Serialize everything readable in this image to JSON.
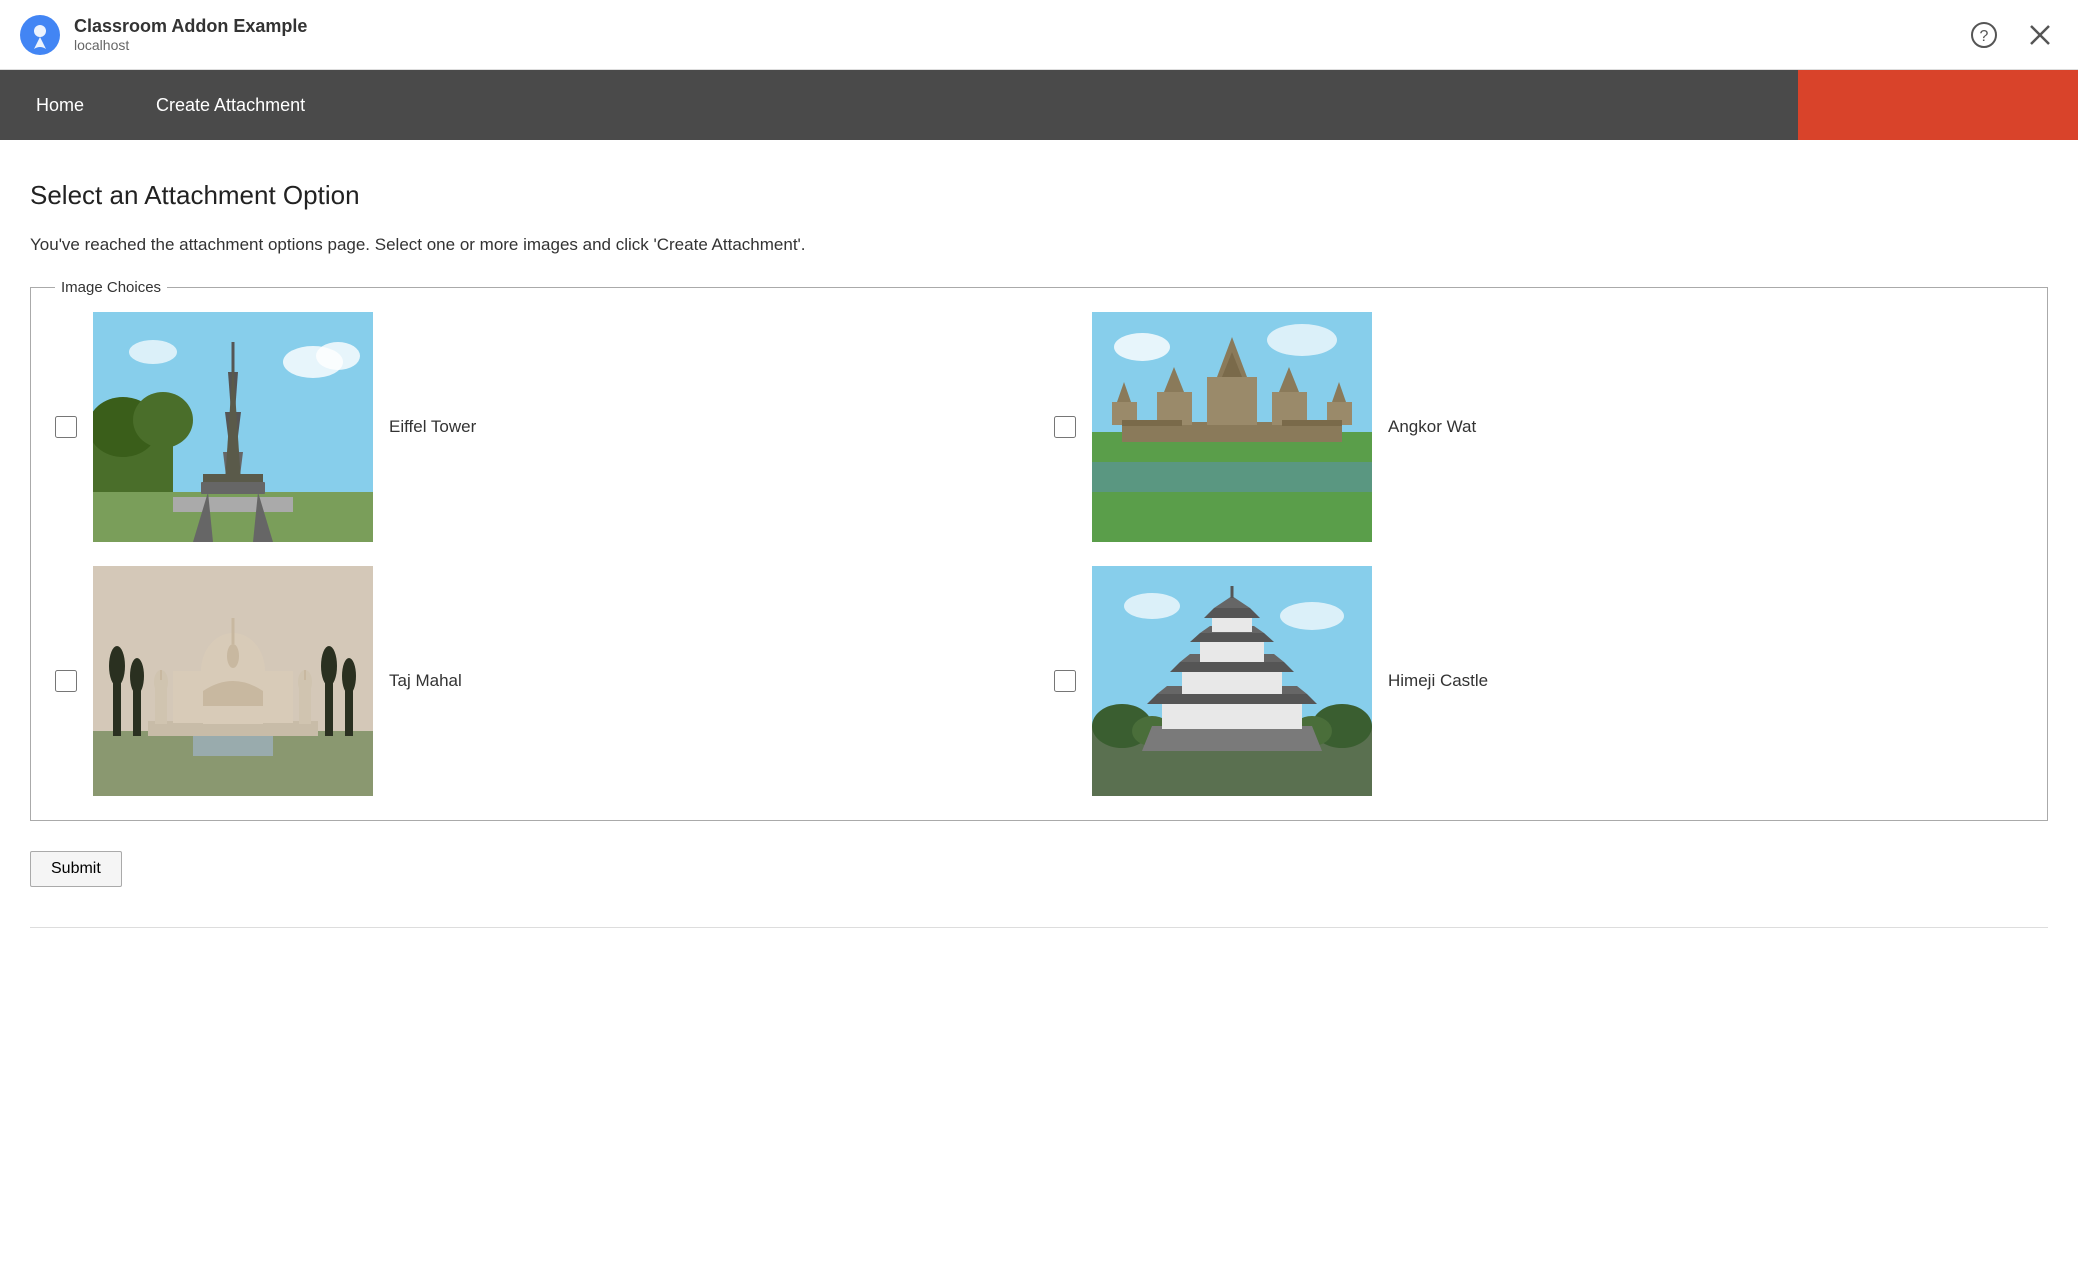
{
  "titleBar": {
    "appTitle": "Classroom Addon Example",
    "appSubtitle": "localhost",
    "helpIconLabel": "?",
    "closeIconLabel": "×"
  },
  "navBar": {
    "homeLabel": "Home",
    "createAttachmentLabel": "Create Attachment",
    "actionBtnColor": "#d9432a"
  },
  "mainContent": {
    "pageTitle": "Select an Attachment Option",
    "description": "You've reached the attachment options page. Select one or more images and click 'Create Attachment'.",
    "fieldsetLegend": "Image Choices",
    "images": [
      {
        "id": "eiffel",
        "label": "Eiffel Tower",
        "type": "eiffel-tower"
      },
      {
        "id": "angkor",
        "label": "Angkor Wat",
        "type": "angkor-wat"
      },
      {
        "id": "taj",
        "label": "Taj Mahal",
        "type": "taj-mahal"
      },
      {
        "id": "himeji",
        "label": "Himeji Castle",
        "type": "himeji-castle"
      }
    ],
    "submitLabel": "Submit"
  }
}
